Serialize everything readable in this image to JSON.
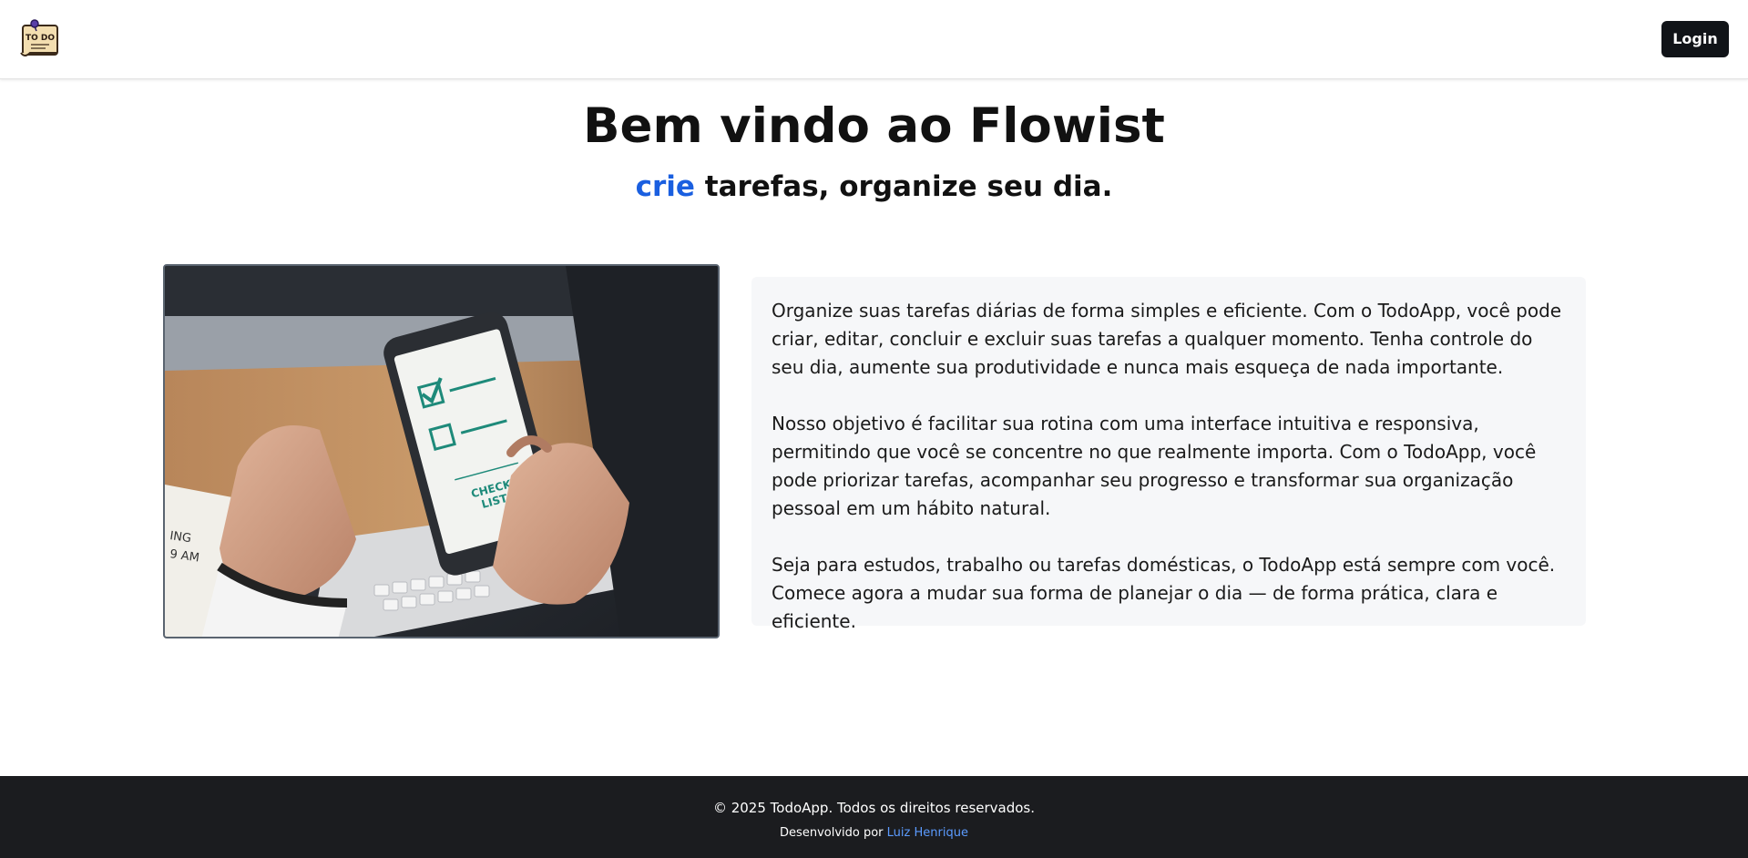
{
  "navbar": {
    "logo_text": "TO DO",
    "login_label": "Login"
  },
  "hero": {
    "title": "Bem vindo ao Flowist",
    "subtitle_accent": "crie",
    "subtitle_rest": " tarefas, organize seu dia."
  },
  "photo": {
    "checklist_text_line1": "CHECK",
    "checklist_text_line2": "LIST",
    "note_text_line1": "ING",
    "note_text_line2": "9 AM"
  },
  "description": {
    "paragraphs": [
      "Organize suas tarefas diárias de forma simples e eficiente. Com o TodoApp, você pode criar, editar, concluir e excluir suas tarefas a qualquer momento. Tenha controle do seu dia, aumente sua produtividade e nunca mais esqueça de nada importante.",
      "Nosso objetivo é facilitar sua rotina com uma interface intuitiva e responsiva, permitindo que você se concentre no que realmente importa. Com o TodoApp, você pode priorizar tarefas, acompanhar seu progresso e transformar sua organização pessoal em um hábito natural.",
      "Seja para estudos, trabalho ou tarefas domésticas, o TodoApp está sempre com você. Comece agora a mudar sua forma de planejar o dia — de forma prática, clara e eficiente."
    ]
  },
  "footer": {
    "copyright": "© 2025 TodoApp. Todos os direitos reservados.",
    "credit_prefix": "Desenvolvido por ",
    "credit_name": "Luiz Henrique"
  },
  "colors": {
    "accent": "#1a5fe0",
    "footer_bg": "#1b1c1f",
    "button_bg": "#111418",
    "card_bg": "#f6f7f9",
    "link": "#5b9bff"
  }
}
